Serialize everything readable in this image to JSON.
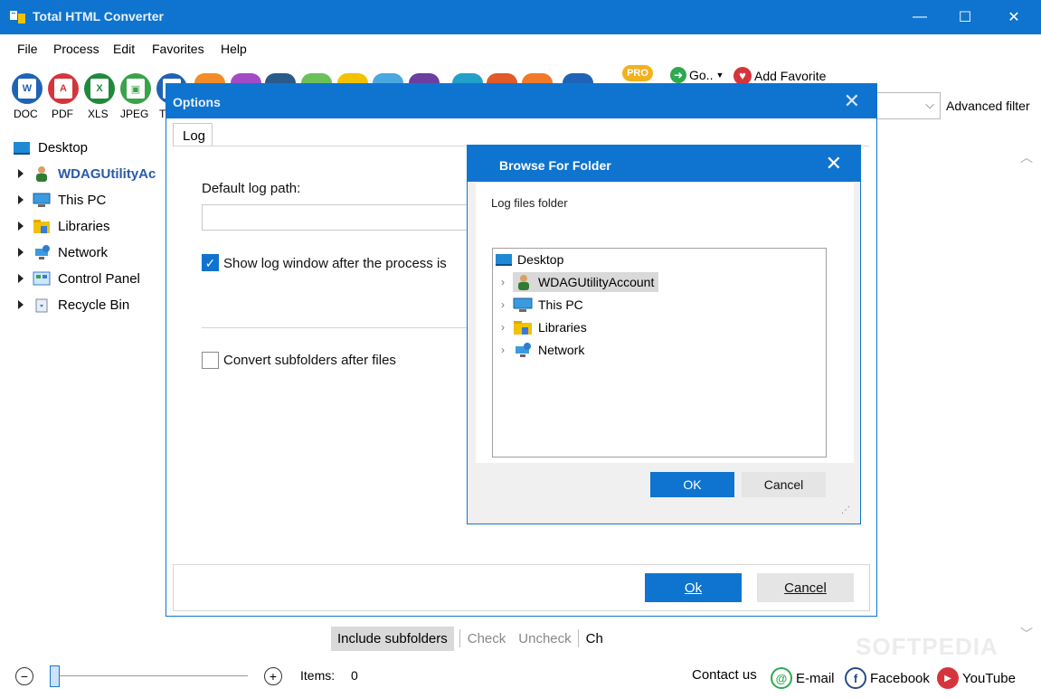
{
  "app": {
    "title": "Total HTML Converter"
  },
  "window_controls": {
    "minimize": "—",
    "maximize": "☐",
    "close": "✕"
  },
  "menu": [
    "File",
    "Process",
    "Edit",
    "Favorites",
    "Help"
  ],
  "toolbar": {
    "formats": [
      {
        "label": "DOC",
        "color": "#1f63b6",
        "glyph": "W"
      },
      {
        "label": "PDF",
        "color": "#d6343c",
        "glyph": "A"
      },
      {
        "label": "XLS",
        "color": "#1f8a3c",
        "glyph": "X"
      },
      {
        "label": "JPEG",
        "color": "#3aa34a",
        "glyph": "▣"
      },
      {
        "label": "T",
        "color": "#1f63b6",
        "glyph": "T"
      }
    ],
    "pro_badge": "PRO",
    "go_label": "Go..",
    "add_favorite_label": "Add Favorite",
    "advanced_filter_label": "Advanced filter"
  },
  "tree": [
    {
      "label": "Desktop",
      "icon": "desktop-icon"
    },
    {
      "label": "WDAGUtilityAc",
      "icon": "user-icon",
      "bold": true
    },
    {
      "label": "This PC",
      "icon": "pc-icon"
    },
    {
      "label": "Libraries",
      "icon": "libraries-icon"
    },
    {
      "label": "Network",
      "icon": "network-icon"
    },
    {
      "label": "Control Panel",
      "icon": "control-panel-icon"
    },
    {
      "label": "Recycle Bin",
      "icon": "recycle-bin-icon"
    }
  ],
  "options_dialog": {
    "title": "Options",
    "tab": "Log",
    "default_log_path_label": "Default log path:",
    "default_log_path_value": "",
    "show_log_label": "Show log window after the process is",
    "show_log_checked": true,
    "convert_subfolders_label": "Convert subfolders after files",
    "convert_subfolders_checked": false,
    "ok_label": "Ok",
    "cancel_label": "Cancel"
  },
  "browse_dialog": {
    "title": "Browse For Folder",
    "description": "Log files folder",
    "items": [
      {
        "label": "Desktop",
        "icon": "desktop-icon"
      },
      {
        "label": "WDAGUtilityAccount",
        "icon": "user-icon",
        "selected": true
      },
      {
        "label": "This PC",
        "icon": "pc-icon"
      },
      {
        "label": "Libraries",
        "icon": "libraries-icon"
      },
      {
        "label": "Network",
        "icon": "network-icon"
      }
    ],
    "ok_label": "OK",
    "cancel_label": "Cancel"
  },
  "bottom_bar": {
    "include_subfolders": "Include subfolders",
    "check": "Check",
    "uncheck": "Uncheck",
    "ch": "Ch"
  },
  "status": {
    "items_label": "Items:",
    "items_count": "0",
    "contact_us": "Contact us",
    "email": "E-mail",
    "facebook": "Facebook",
    "youtube": "YouTube",
    "watermark": "SOFTPEDIA"
  }
}
